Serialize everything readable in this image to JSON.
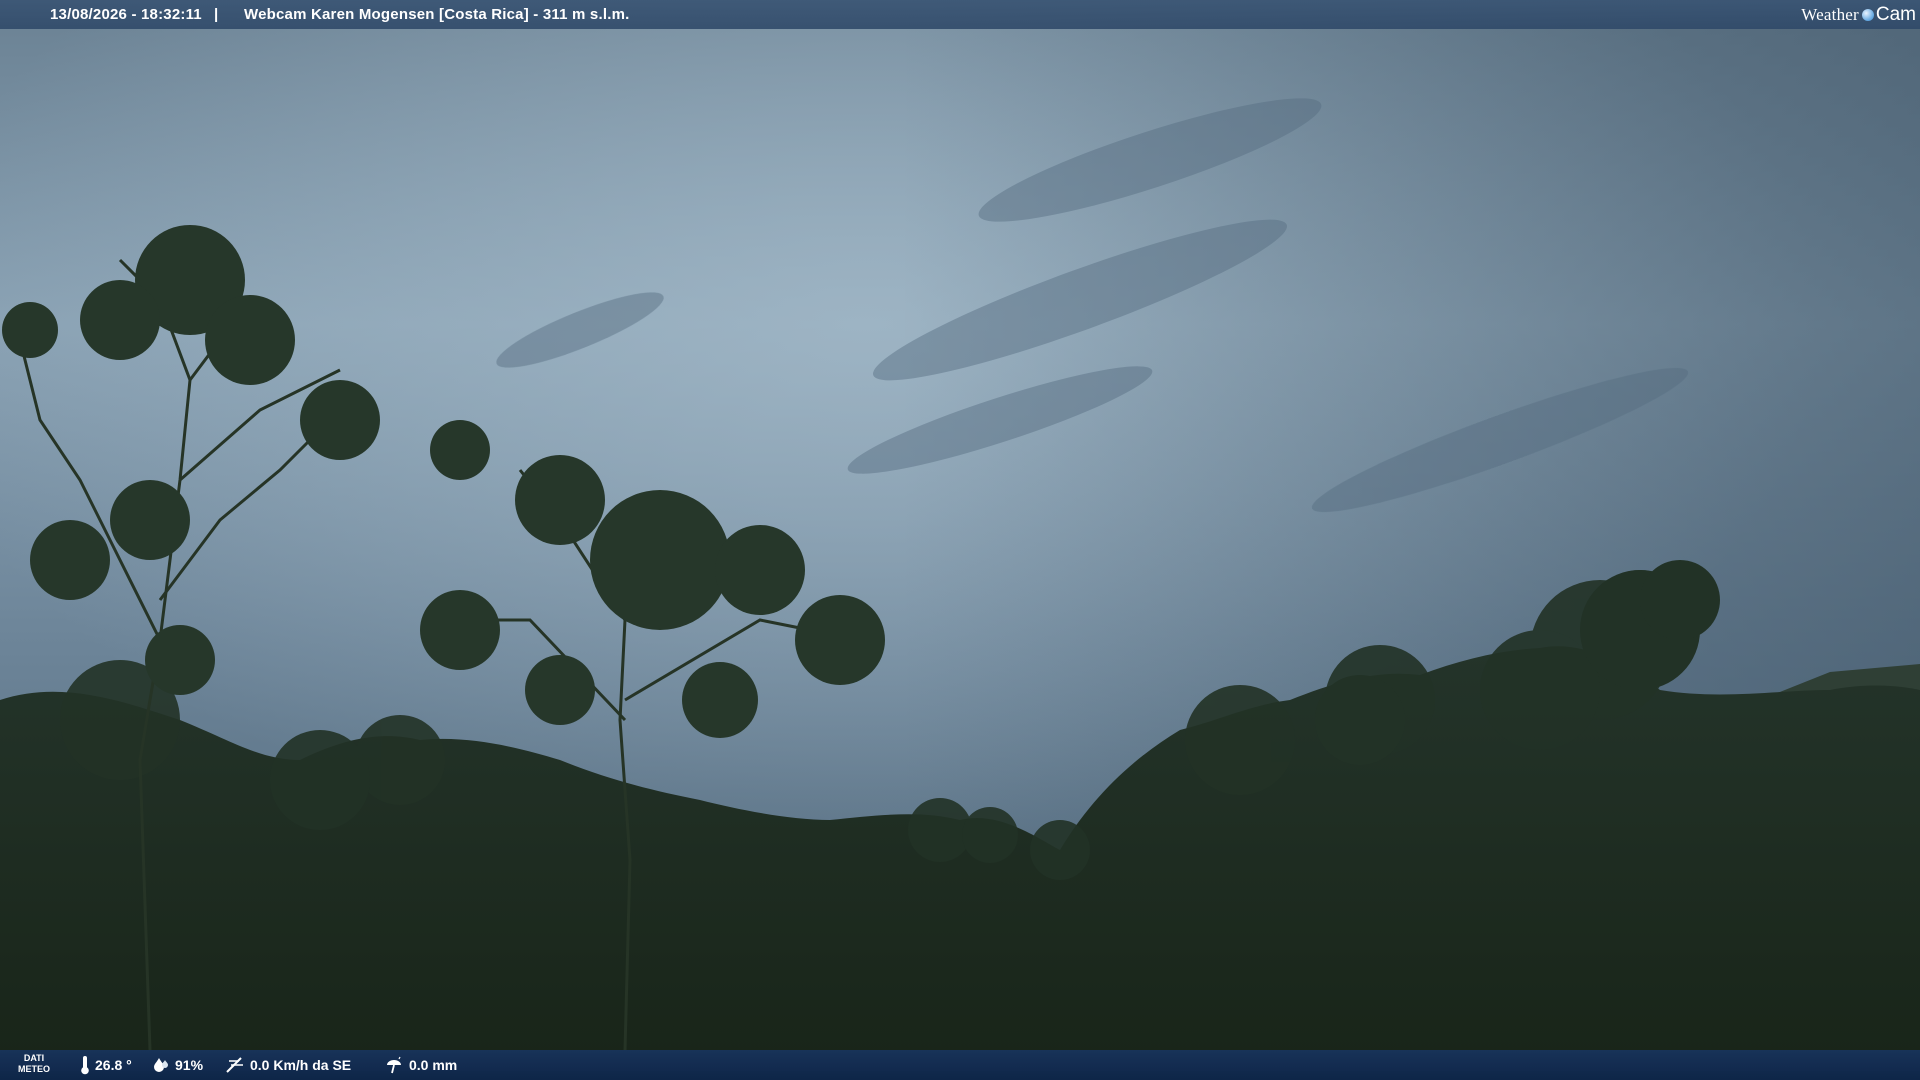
{
  "header": {
    "timestamp": "13/08/2026 - 18:32:11",
    "separator": "|",
    "title": "Webcam Karen Mogensen [Costa Rica]  - 311 m s.l.m."
  },
  "brand": {
    "left_text": "Weather",
    "right_text": "Cam",
    "logo_icon": "globe-icon"
  },
  "footer": {
    "dati_line1": "DATI",
    "dati_line2": "METEO",
    "temperature": "26.8 °",
    "humidity": "91%",
    "wind": "0.0 Km/h da SE",
    "rain": "0.0 mm",
    "icons": {
      "temperature": "thermometer-icon",
      "humidity": "humidity-drop-icon",
      "wind": "wind-icon",
      "rain": "rain-gauge-icon"
    }
  },
  "colors": {
    "sky_top": "#6d8597",
    "sky_mid": "#8ea5b6",
    "sky_low": "#5b7286",
    "foliage": "#1d2d1f",
    "topbar": "#3a5574",
    "bottombar": "#16345c"
  }
}
